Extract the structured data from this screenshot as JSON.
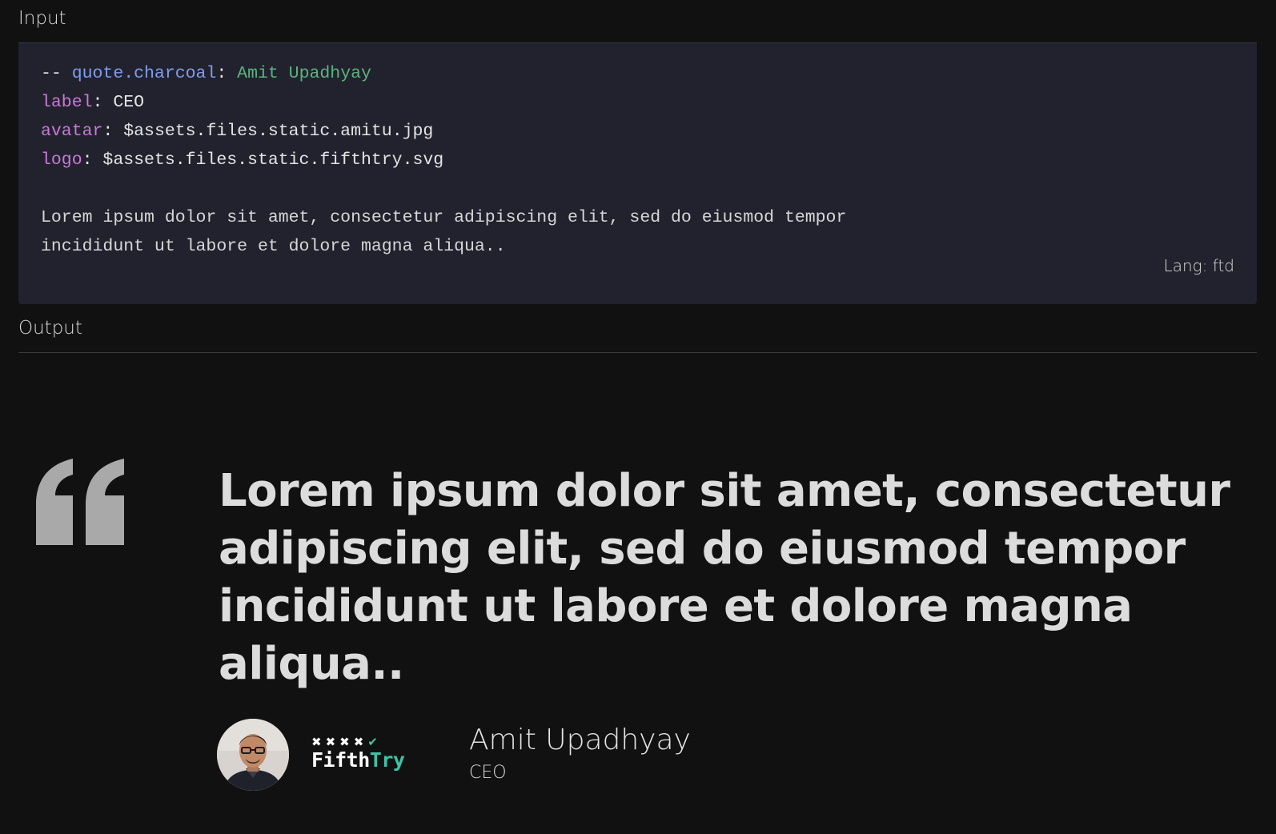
{
  "sections": {
    "input_label": "Input",
    "output_label": "Output"
  },
  "code": {
    "line1": {
      "prefix": "-- ",
      "component": "quote.charcoal",
      "sep": ": ",
      "value": "Amit Upadhyay"
    },
    "line2": {
      "key": "label",
      "sep": ": ",
      "value": "CEO"
    },
    "line3": {
      "key": "avatar",
      "sep": ": ",
      "value": "$assets.files.static.amitu.jpg"
    },
    "line4": {
      "key": "logo",
      "sep": ": ",
      "value": "$assets.files.static.fifthtry.svg"
    },
    "body_line1": "Lorem ipsum dolor sit amet, consectetur adipiscing elit, sed do eiusmod tempor",
    "body_line2": "incididunt ut labore et dolore magna aliqua..",
    "lang": "Lang: ftd"
  },
  "output": {
    "quote": "Lorem ipsum dolor sit amet, consectetur adipiscing elit, sed do eiusmod tempor incididunt ut labore et dolore magna aliqua..",
    "author_name": "Amit Upadhyay",
    "author_label": "CEO",
    "logo": {
      "word_main": "Fifth",
      "word_accent": "Try"
    },
    "icons": {
      "quote": "quote-mark-icon",
      "avatar": "avatar-photo",
      "logo": "fifthtry-logo"
    },
    "colors": {
      "accent": "#3fc3a6",
      "quote_mark": "#a9a9a9"
    }
  }
}
